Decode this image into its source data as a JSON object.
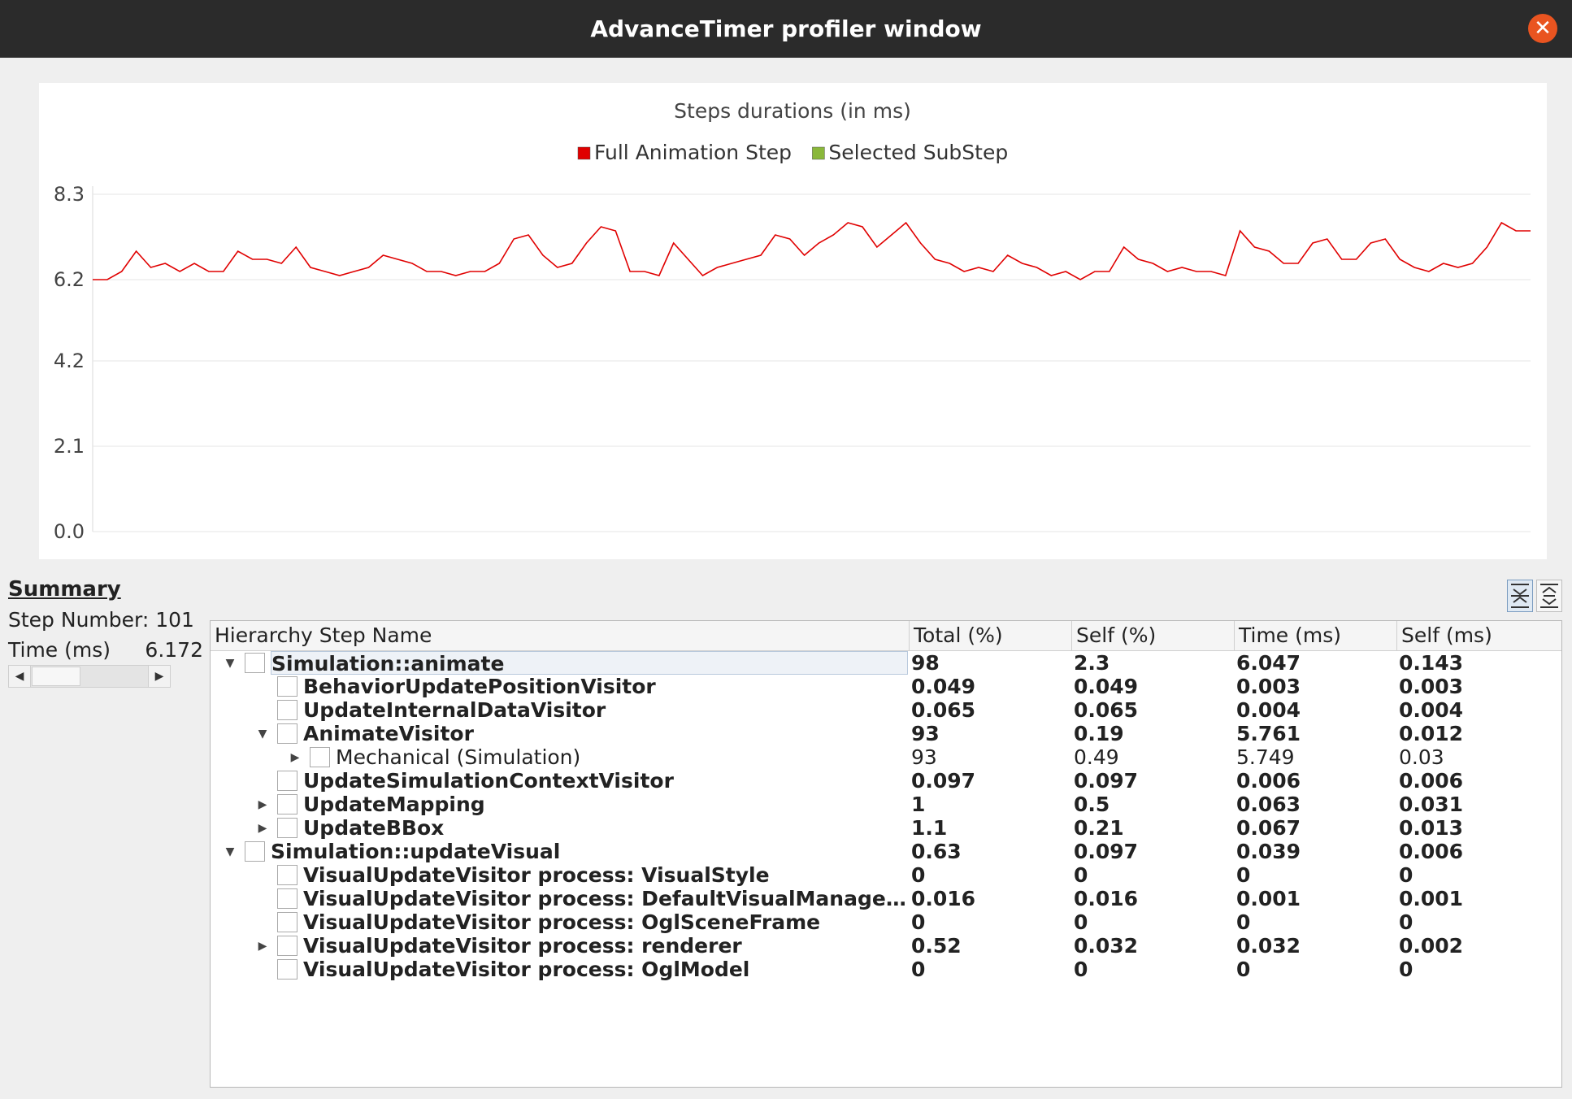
{
  "window": {
    "title": "AdvanceTimer profiler window"
  },
  "chart_data": {
    "type": "line",
    "title": "Steps durations (in ms)",
    "legend": [
      {
        "label": "Full Animation Step",
        "color": "#e00000"
      },
      {
        "label": "Selected SubStep",
        "color": "#8ab83a"
      }
    ],
    "legend_position": "top-center",
    "y_ticks": [
      "8.3",
      "6.2",
      "4.2",
      "2.1",
      "0.0"
    ],
    "ylim": [
      0,
      8.3
    ],
    "grid": true,
    "series": [
      {
        "name": "Full Animation Step",
        "color": "#e00000",
        "values": [
          6.2,
          6.2,
          6.4,
          6.9,
          6.5,
          6.6,
          6.4,
          6.6,
          6.4,
          6.4,
          6.9,
          6.7,
          6.7,
          6.6,
          7.0,
          6.5,
          6.4,
          6.3,
          6.4,
          6.5,
          6.8,
          6.7,
          6.6,
          6.4,
          6.4,
          6.3,
          6.4,
          6.4,
          6.6,
          7.2,
          7.3,
          6.8,
          6.5,
          6.6,
          7.1,
          7.5,
          7.4,
          6.4,
          6.4,
          6.3,
          7.1,
          6.7,
          6.3,
          6.5,
          6.6,
          6.7,
          6.8,
          7.3,
          7.2,
          6.8,
          7.1,
          7.3,
          7.6,
          7.5,
          7.0,
          7.3,
          7.6,
          7.1,
          6.7,
          6.6,
          6.4,
          6.5,
          6.4,
          6.8,
          6.6,
          6.5,
          6.3,
          6.4,
          6.2,
          6.4,
          6.4,
          7.0,
          6.7,
          6.6,
          6.4,
          6.5,
          6.4,
          6.4,
          6.3,
          7.4,
          7.0,
          6.9,
          6.6,
          6.6,
          7.1,
          7.2,
          6.7,
          6.7,
          7.1,
          7.2,
          6.7,
          6.5,
          6.4,
          6.6,
          6.5,
          6.6,
          7.0,
          7.6,
          7.4,
          7.4
        ]
      }
    ]
  },
  "summary": {
    "title": "Summary",
    "step_number_label": "Step Number:",
    "step_number_value": "101",
    "time_label": "Time (ms)",
    "time_value": "6.172"
  },
  "icons": {
    "collapse_all": "collapse-all-icon",
    "expand_all": "expand-all-icon"
  },
  "tree": {
    "headers": [
      "Hierarchy Step Name",
      "Total (%)",
      "Self (%)",
      "Time (ms)",
      "Self (ms)"
    ],
    "rows": [
      {
        "name": "Simulation::animate",
        "level": 0,
        "expander": "open",
        "bold": true,
        "selected": true,
        "total": "98",
        "self_pct": "2.3",
        "time": "6.047",
        "self_ms": "0.143"
      },
      {
        "name": "BehaviorUpdatePositionVisitor",
        "level": 1,
        "expander": "none",
        "bold": true,
        "total": "0.049",
        "self_pct": "0.049",
        "time": "0.003",
        "self_ms": "0.003"
      },
      {
        "name": "UpdateInternalDataVisitor",
        "level": 1,
        "expander": "none",
        "bold": true,
        "total": "0.065",
        "self_pct": "0.065",
        "time": "0.004",
        "self_ms": "0.004"
      },
      {
        "name": "AnimateVisitor",
        "level": 1,
        "expander": "open",
        "bold": true,
        "total": "93",
        "self_pct": "0.19",
        "time": "5.761",
        "self_ms": "0.012"
      },
      {
        "name": "Mechanical (Simulation)",
        "level": 2,
        "expander": "closed",
        "bold": false,
        "total": "93",
        "self_pct": "0.49",
        "time": "5.749",
        "self_ms": "0.03"
      },
      {
        "name": "UpdateSimulationContextVisitor",
        "level": 1,
        "expander": "none",
        "bold": true,
        "total": "0.097",
        "self_pct": "0.097",
        "time": "0.006",
        "self_ms": "0.006"
      },
      {
        "name": "UpdateMapping",
        "level": 1,
        "expander": "closed",
        "bold": true,
        "total": "1",
        "self_pct": "0.5",
        "time": "0.063",
        "self_ms": "0.031"
      },
      {
        "name": "UpdateBBox",
        "level": 1,
        "expander": "closed",
        "bold": true,
        "total": "1.1",
        "self_pct": "0.21",
        "time": "0.067",
        "self_ms": "0.013"
      },
      {
        "name": "Simulation::updateVisual",
        "level": 0,
        "expander": "open",
        "bold": true,
        "total": "0.63",
        "self_pct": "0.097",
        "time": "0.039",
        "self_ms": "0.006"
      },
      {
        "name": "VisualUpdateVisitor process: VisualStyle",
        "level": 1,
        "expander": "none",
        "bold": true,
        "total": "0",
        "self_pct": "0",
        "time": "0",
        "self_ms": "0"
      },
      {
        "name": "VisualUpdateVisitor process: DefaultVisualManagerL...",
        "level": 1,
        "expander": "none",
        "bold": true,
        "total": "0.016",
        "self_pct": "0.016",
        "time": "0.001",
        "self_ms": "0.001"
      },
      {
        "name": "VisualUpdateVisitor process: OglSceneFrame",
        "level": 1,
        "expander": "none",
        "bold": true,
        "total": "0",
        "self_pct": "0",
        "time": "0",
        "self_ms": "0"
      },
      {
        "name": "VisualUpdateVisitor process: renderer",
        "level": 1,
        "expander": "closed",
        "bold": true,
        "total": "0.52",
        "self_pct": "0.032",
        "time": "0.032",
        "self_ms": "0.002"
      },
      {
        "name": "VisualUpdateVisitor process: OglModel",
        "level": 1,
        "expander": "none",
        "bold": true,
        "total": "0",
        "self_pct": "0",
        "time": "0",
        "self_ms": "0"
      }
    ]
  }
}
